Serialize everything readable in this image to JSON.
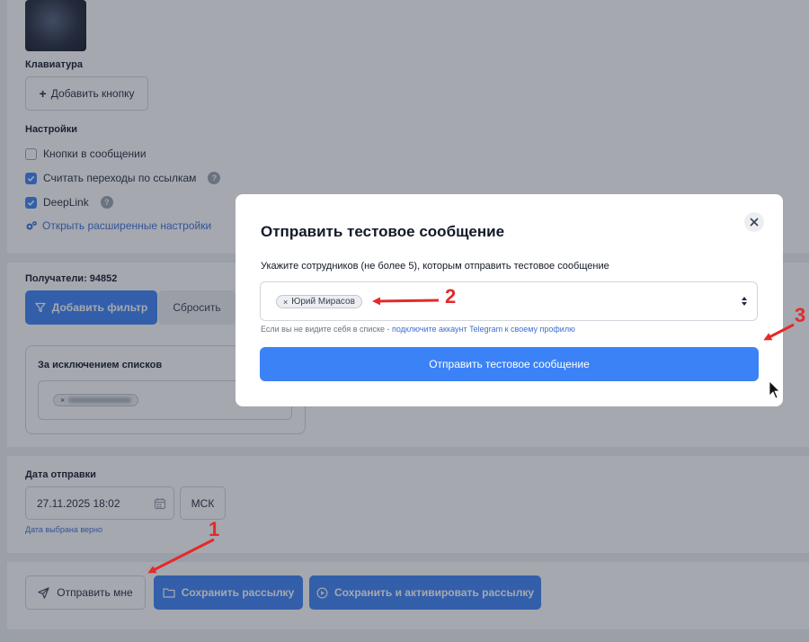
{
  "keyboard": {
    "label": "Клавиатура",
    "add_button": "Добавить кнопку"
  },
  "settings": {
    "label": "Настройки",
    "options": [
      {
        "label": "Кнопки в сообщении",
        "checked": false,
        "help": false
      },
      {
        "label": "Считать переходы по ссылкам",
        "checked": true,
        "help": true
      },
      {
        "label": "DeepLink",
        "checked": true,
        "help": true
      }
    ],
    "advanced_link": "Открыть расширенные настройки"
  },
  "recipients": {
    "label": "Получатели: 94852",
    "add_filter": "Добавить фильтр",
    "reset": "Сбросить",
    "exclude_label": "За исключением списков"
  },
  "send_date": {
    "label": "Дата отправки",
    "value": "27.11.2025 18:02",
    "timezone": "МСК",
    "hint": "Дата выбрана верно"
  },
  "actions": {
    "send_me": "Отправить мне",
    "save": "Сохранить рассылку",
    "save_activate": "Сохранить и активировать рассылку"
  },
  "modal": {
    "title": "Отправить тестовое сообщение",
    "instruction": "Укажите сотрудников (не более 5), которым отправить тестовое сообщение",
    "selected_tag": "Юрий Мирасов",
    "hint_prefix": "Если вы не видите себя в списке - ",
    "hint_link": "подключите аккаунт Telegram к своему профилю",
    "send_button": "Отправить тестовое сообщение"
  },
  "annotations": {
    "one": "1",
    "two": "2",
    "three": "3"
  },
  "colors": {
    "primary": "#3b82f6",
    "annotation": "#e42a2a",
    "link": "#3b6ed6"
  },
  "icons": {
    "plus": "plus-icon",
    "gear": "gears-icon",
    "filter": "filter-icon",
    "calendar": "calendar-icon",
    "send": "paper-plane-icon",
    "folder": "folder-icon",
    "play": "play-circle-icon",
    "close": "close-icon",
    "sort": "sort-icon",
    "help": "question-icon"
  }
}
